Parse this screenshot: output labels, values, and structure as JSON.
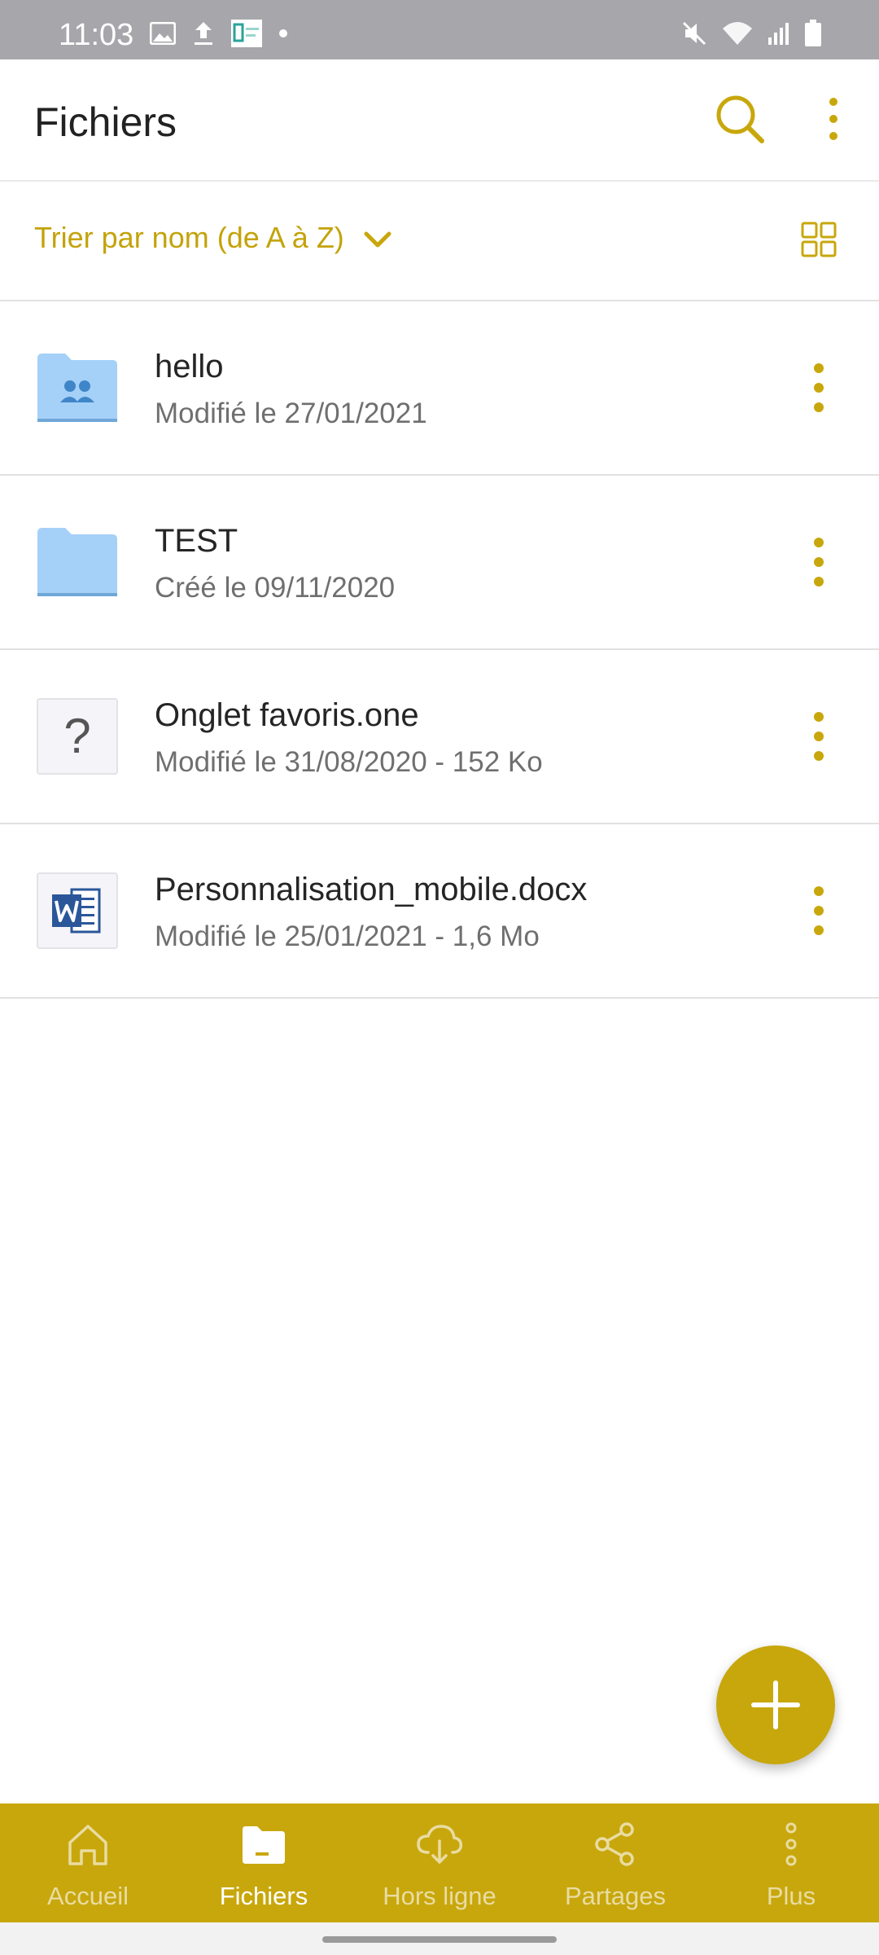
{
  "status_bar": {
    "time": "11:03",
    "left_icons": [
      "image-icon",
      "upload-icon",
      "app-notification-icon",
      "dot-icon"
    ],
    "right_icons": [
      "mute-icon",
      "wifi-icon",
      "signal-icon",
      "battery-icon"
    ]
  },
  "appbar": {
    "title": "Fichiers",
    "search_icon": "search-icon",
    "more_icon": "more-vertical-icon"
  },
  "sortbar": {
    "label": "Trier par nom (de A à Z)",
    "toggle_icon": "grid-view-icon"
  },
  "files": [
    {
      "name": "hello",
      "meta": "Modifié le 27/01/2021",
      "icon": "shared-folder-icon"
    },
    {
      "name": "TEST",
      "meta": "Créé le 09/11/2020",
      "icon": "folder-icon"
    },
    {
      "name": "Onglet favoris.one",
      "meta": "Modifié le 31/08/2020 - 152 Ko",
      "icon": "unknown-file-icon"
    },
    {
      "name": "Personnalisation_mobile.docx",
      "meta": "Modifié le 25/01/2021 - 1,6 Mo",
      "icon": "word-file-icon"
    }
  ],
  "nav": {
    "items": [
      {
        "label": "Accueil",
        "icon": "home-icon"
      },
      {
        "label": "Fichiers",
        "icon": "folder-icon"
      },
      {
        "label": "Hors ligne",
        "icon": "cloud-download-icon"
      },
      {
        "label": "Partages",
        "icon": "share-icon"
      },
      {
        "label": "Plus",
        "icon": "more-vertical-icon"
      }
    ],
    "active": "Fichiers"
  },
  "colors": {
    "accent": "#c8a70c",
    "status_bar": "#a7a6aa",
    "folder": "#a5d0f8"
  }
}
